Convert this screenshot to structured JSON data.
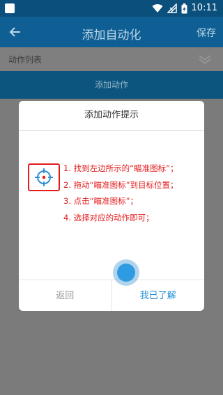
{
  "status_bar": {
    "time": "10:11"
  },
  "app_bar": {
    "title": "添加自动化",
    "save_label": "保存"
  },
  "section": {
    "label": "动作列表"
  },
  "add_action": {
    "label": "添加动作"
  },
  "dialog": {
    "title": "添加动作提示",
    "steps": [
      "1. 找到左边所示的“瞄准图标”；",
      "2. 拖动“瞄准图标”到目标位置；",
      "3. 点击“瞄准图标”；",
      "4. 选择对应的动作即可；"
    ],
    "back_label": "返回",
    "ok_label": "我已了解"
  },
  "colors": {
    "app_bar": "#0f5f94",
    "status_bar": "#0b4f7c",
    "accent": "#1e8fd6",
    "step_text": "#e31b1b"
  },
  "icons": [
    "back-arrow-icon",
    "chevron-down-icon",
    "target-icon",
    "wifi-icon",
    "signal-icon",
    "battery-icon"
  ]
}
